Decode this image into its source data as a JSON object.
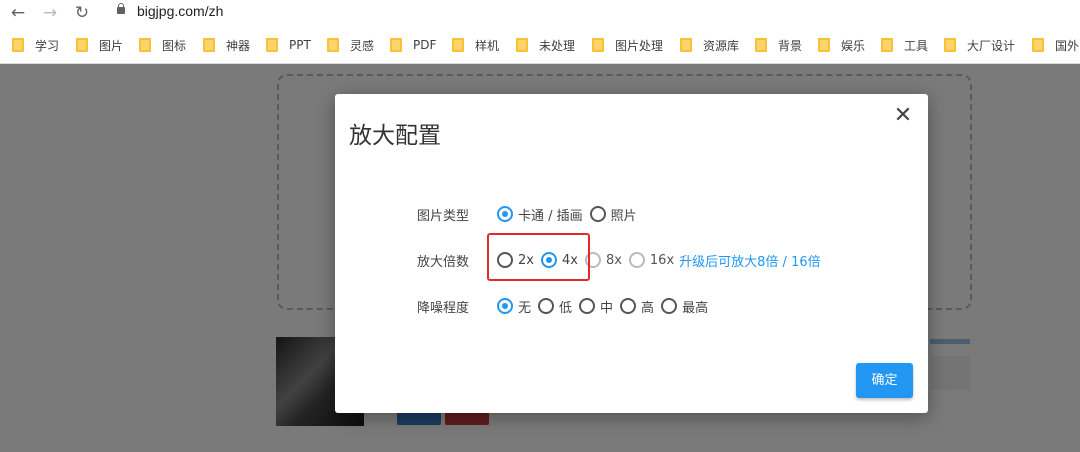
{
  "browser": {
    "url": "bigjpg.com/zh",
    "nav": {
      "back_icon": "←",
      "forward_icon": "→",
      "reload_icon": "↻"
    }
  },
  "bookmarks": [
    "学习",
    "图片",
    "图标",
    "神器",
    "PPT",
    "灵感",
    "PDF",
    "样机",
    "未处理",
    "图片处理",
    "资源库",
    "背景",
    "娱乐",
    "工具",
    "大厂设计",
    "国外"
  ],
  "dialog": {
    "title": "放大配置",
    "close_label": "✕",
    "rows": [
      {
        "label": "图片类型",
        "options": [
          {
            "text": "卡通 / 插画",
            "selected": true
          },
          {
            "text": "照片",
            "selected": false
          }
        ]
      },
      {
        "label": "放大倍数",
        "options": [
          {
            "text": "2x",
            "selected": false
          },
          {
            "text": "4x",
            "selected": true
          },
          {
            "text": "8x",
            "selected": false,
            "disabled": true
          },
          {
            "text": "16x",
            "selected": false,
            "disabled": true
          }
        ],
        "note": "升级后可放大8倍 / 16倍"
      },
      {
        "label": "降噪程度",
        "options": [
          {
            "text": "无",
            "selected": true
          },
          {
            "text": "低",
            "selected": false
          },
          {
            "text": "中",
            "selected": false
          },
          {
            "text": "高",
            "selected": false
          },
          {
            "text": "最高",
            "selected": false
          }
        ]
      }
    ],
    "confirm_label": "确定"
  },
  "colors": {
    "accent": "#2196f3",
    "highlight": "#e02b2b",
    "overlay": "rgba(0,0,0,0.52)"
  }
}
